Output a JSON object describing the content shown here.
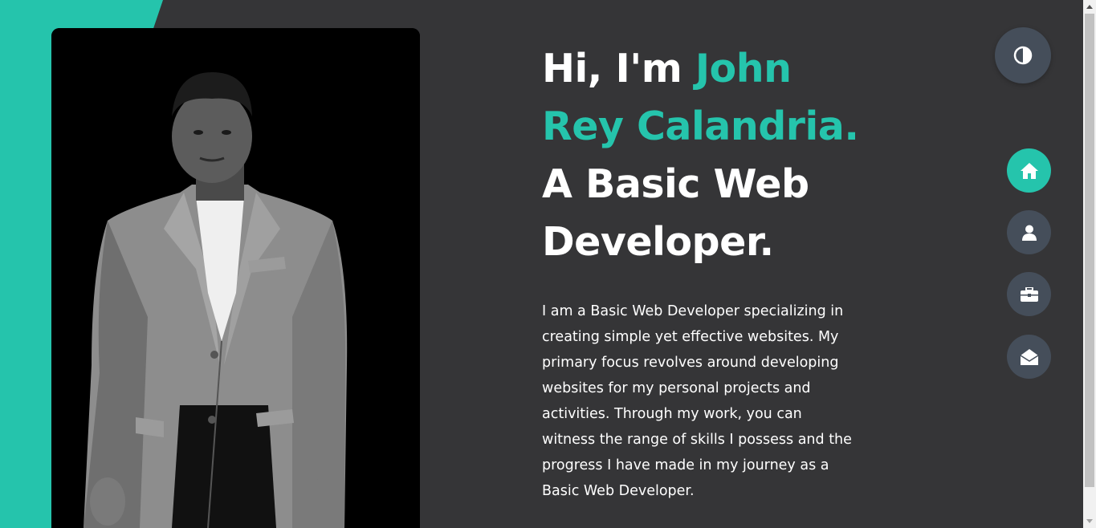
{
  "hero": {
    "greeting": "Hi, I'm ",
    "name": "John Rey Calandria.",
    "title_rest": " A Basic Web Developer.",
    "bio": "I am a Basic Web Developer specializing in creating simple yet effective websites. My primary focus revolves around developing websites for my personal projects and activities. Through my work, you can witness the range of skills I possess and the progress I have made in my journey as a Basic Web Developer."
  },
  "controls": {
    "theme_toggle_icon": "contrast-icon"
  },
  "nav": {
    "items": [
      {
        "icon": "home-icon",
        "active": true
      },
      {
        "icon": "user-icon",
        "active": false
      },
      {
        "icon": "briefcase-icon",
        "active": false
      },
      {
        "icon": "envelope-open-icon",
        "active": false
      }
    ]
  },
  "colors": {
    "accent": "#25c4ac",
    "background": "#353537",
    "button": "#454e5a",
    "text": "#ffffff"
  }
}
